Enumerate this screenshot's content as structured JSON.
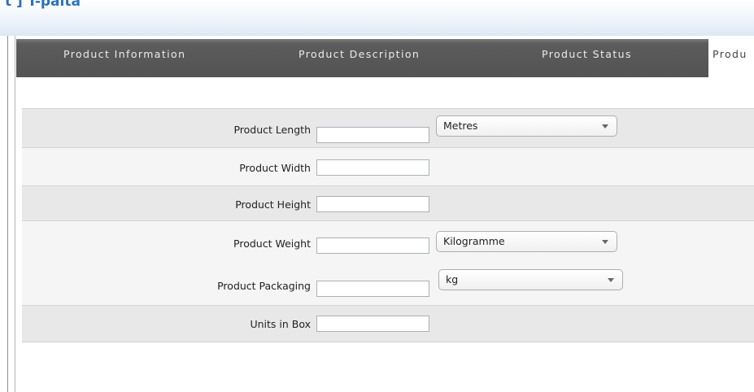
{
  "header": {
    "title": "t ] T-paita"
  },
  "tabs": [
    {
      "label": "Product Information"
    },
    {
      "label": "Product Description"
    },
    {
      "label": "Product Status"
    },
    {
      "label": "Produ"
    }
  ],
  "form": {
    "rows": [
      {
        "label": "Product Length",
        "value": "",
        "unit": "Metres"
      },
      {
        "label": "Product Width",
        "value": ""
      },
      {
        "label": "Product Height",
        "value": ""
      },
      {
        "label": "Product Weight",
        "value": "",
        "unit": "Kilogramme"
      },
      {
        "label": "Product Packaging",
        "value": "",
        "unit": "kg"
      },
      {
        "label": "Units in Box",
        "value": ""
      }
    ]
  }
}
